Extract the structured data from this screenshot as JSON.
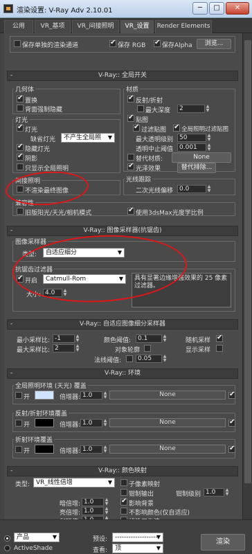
{
  "window": {
    "title": "渲染设置: V-Ray Adv 2.10.01",
    "minimize": "─",
    "maximize": "□",
    "close": "✕"
  },
  "tabs": [
    "公用",
    "VR_基项",
    "VR_间接照明",
    "VR_设置",
    "Render Elements"
  ],
  "top_row": {
    "save_separate": "保存单独的渲染通道",
    "save_rgb": "保存 RGB",
    "save_alpha": "保存Alpha",
    "browse": "浏览..."
  },
  "global_switches": {
    "header": "V-Ray:: 全局开关",
    "geometry": {
      "title": "几何体",
      "displacement": "置换",
      "force_backface": "背面强制隐藏"
    },
    "lights": {
      "title": "灯光",
      "lights": "灯光",
      "default_lights_label": "缺省灯光",
      "default_lights_value": "不产生全局照",
      "hidden_lights": "隐藏灯光",
      "shadows": "阴影",
      "show_gi_only": "只显示全局照明"
    },
    "materials": {
      "title": "材质",
      "reflection": "反射/折射",
      "max_depth": "最大深度",
      "max_depth_value": "2",
      "maps": "贴图",
      "filter_maps": "过滤贴图",
      "filter_gi": "全局照明过滤贴图",
      "max_transp": "最大透明级别",
      "max_transp_value": "50",
      "transp_cutoff": "透明中止阈值",
      "transp_cutoff_value": "0.001",
      "override_mtl": "替代材质:",
      "override_value": "None",
      "glossy": "光泽效果",
      "override_exclude": "替代排除..."
    },
    "indirect": {
      "title": "间接照明",
      "dont_render_final": "不渲染最终图像"
    },
    "raytracing": {
      "title": "光线跟踪",
      "secondary_bias": "二次光线偏移",
      "secondary_bias_value": "0.0"
    },
    "compat": {
      "title": "兼容性",
      "legacy_sun": "旧版阳光/天光/相机模式",
      "use_3dsmax_scale": "使用3dsMax光度学比例"
    }
  },
  "image_sampler": {
    "header": "V-Ray:: 图像采样器(抗锯齿)",
    "sampler": {
      "title": "图像采样器",
      "type_label": "类型:",
      "type_value": "自适应细分"
    },
    "aa_filter": {
      "title": "抗锯齿过滤器",
      "on": "开启",
      "filter_value": "Catmull-Rom",
      "desc": "具有显著边缘增强效果的 25 像素过滤器。",
      "size_label": "大小:",
      "size_value": "4.0"
    }
  },
  "adaptive": {
    "header": "V-Ray:: 自适应图像细分采样器",
    "min_rate": "最小采样比:",
    "min_rate_value": "-1",
    "max_rate": "最大采样比:",
    "max_rate_value": "2",
    "clr_thresh": "颜色阈值:",
    "clr_thresh_value": "0.1",
    "object_outline": "对象轮廓",
    "normal_thresh": "法线阈值:",
    "normal_thresh_value": "0.05",
    "randomize": "随机采样",
    "show_samples": "显示采样"
  },
  "environment": {
    "header": "V-Ray:: 环境",
    "gi_env": {
      "title": "全局照明环境 (天光) 覆盖",
      "on": "开",
      "mult": "倍增器:",
      "mult_value": "1.0",
      "map": "None"
    },
    "refl_env": {
      "title": "反射/折射环境覆盖",
      "on": "开",
      "mult": "倍增器:",
      "mult_value": "1.0",
      "map": "None"
    },
    "refr_env": {
      "title": "折射环境覆盖",
      "on": "开",
      "mult": "倍增器:",
      "mult_value": "1.0",
      "map": "None"
    }
  },
  "color_mapping": {
    "header": "V-Ray:: 颜色映射",
    "type_label": "类型:",
    "type_value": "VR_线性倍增",
    "subpixel": "子像素映射",
    "clamp_output": "钳制输出",
    "clamp_level": "钳制级别",
    "clamp_level_value": "1.0",
    "dark_mult": "暗倍增:",
    "dark_mult_value": "1.0",
    "bright_mult": "亮倍增:",
    "bright_mult_value": "1.0",
    "gamma": "伽玛值:",
    "gamma_value": "1.0",
    "affect_bg": "影响背景",
    "no_affect_colors": "不影响颜色(仅自适应)",
    "linear_workflow": "线性工作流"
  },
  "bottom": {
    "product": "产品",
    "activeshade": "ActiveShade",
    "preset_label": "预设:",
    "preset_value": "-------------------",
    "view_label": "查看:",
    "view_value": "顶",
    "render": "渲染"
  },
  "colors": {
    "annotation_red": "#e01515"
  }
}
